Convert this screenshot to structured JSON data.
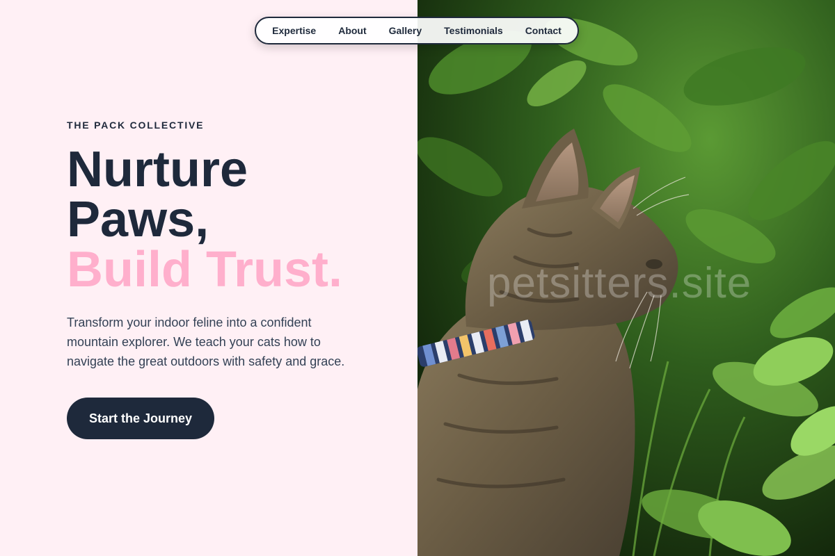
{
  "nav": {
    "items": [
      {
        "label": "Expertise"
      },
      {
        "label": "About"
      },
      {
        "label": "Gallery"
      },
      {
        "label": "Testimonials"
      },
      {
        "label": "Contact"
      }
    ]
  },
  "hero": {
    "eyebrow": "THE PACK COLLECTIVE",
    "headline_line1": "Nurture",
    "headline_line2": "Paws,",
    "headline_accent": "Build Trust.",
    "description": "Transform your indoor feline into a confident mountain explorer. We teach your cats how to navigate the great outdoors with safety and grace.",
    "cta_label": "Start the Journey"
  },
  "image": {
    "watermark": "petsitters.site",
    "subject": "tabby-cat-with-striped-collar-in-green-foliage"
  },
  "colors": {
    "background_left": "#fff0f5",
    "text_dark": "#1e293b",
    "accent_pink": "#ffafcc",
    "button_bg": "#1e293b",
    "button_text": "#ffffff"
  }
}
